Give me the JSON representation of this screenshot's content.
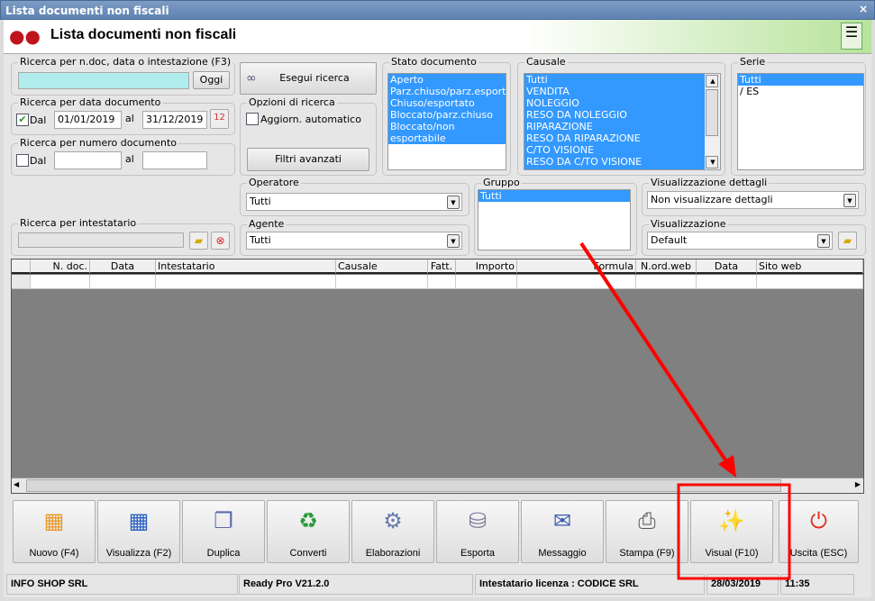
{
  "window": {
    "title": "Lista documenti non fiscali",
    "close": "×"
  },
  "header": {
    "title": "Lista documenti non fiscali"
  },
  "search_ndoc": {
    "legend": "Ricerca per n.doc, data o intestazione (F3)",
    "value": "",
    "today_button": "Oggi"
  },
  "search_date": {
    "legend": "Ricerca per data documento",
    "checked": true,
    "from_label": "Dal",
    "from": "01/01/2019",
    "to_label": "al",
    "to": "31/12/2019"
  },
  "search_number": {
    "legend": "Ricerca per numero documento",
    "checked": false,
    "from_label": "Dal",
    "from": "",
    "to_label": "al",
    "to": ""
  },
  "search_holder": {
    "legend": "Ricerca per intestatario",
    "value": ""
  },
  "run_search": "Esegui ricerca",
  "options": {
    "legend": "Opzioni di ricerca",
    "auto_update": "Aggiorn. automatico",
    "auto_update_checked": false,
    "advanced_filters": "Filtri avanzati"
  },
  "stato": {
    "legend": "Stato documento",
    "items": [
      "Aperto",
      "Parz.chiuso/parz.esportato",
      "Chiuso/esportato",
      "Bloccato/parz.chiuso",
      "Bloccato/non esportabile"
    ]
  },
  "causale": {
    "legend": "Causale",
    "items": [
      "Tutti",
      "VENDITA",
      "NOLEGGIO",
      "RESO DA NOLEGGIO",
      "RIPARAZIONE",
      "RESO DA RIPARAZIONE",
      "C/TO VISIONE",
      "RESO DA C/TO VISIONE"
    ]
  },
  "serie": {
    "legend": "Serie",
    "items": [
      "Tutti",
      "/ ES"
    ]
  },
  "operatore": {
    "legend": "Operatore",
    "value": "Tutti"
  },
  "agente": {
    "legend": "Agente",
    "value": "Tutti"
  },
  "gruppo": {
    "legend": "Gruppo",
    "items": [
      "Tutti"
    ]
  },
  "vis_dettagli": {
    "legend": "Visualizzazione dettagli",
    "value": "Non visualizzare dettagli"
  },
  "visualizzazione": {
    "legend": "Visualizzazione",
    "value": "Default"
  },
  "grid": {
    "columns": [
      "N. doc.",
      "Data",
      "Intestatario",
      "Causale",
      "Fatt.",
      "Importo",
      "Formula",
      "N.ord.web",
      "Data",
      "Sito web"
    ]
  },
  "toolbar": [
    {
      "label": "Nuovo (F4)",
      "icon": "new-grid-icon"
    },
    {
      "label": "Visualizza (F2)",
      "icon": "view-grid-icon"
    },
    {
      "label": "Duplica",
      "icon": "duplicate-icon"
    },
    {
      "label": "Converti",
      "icon": "convert-icon"
    },
    {
      "label": "Elaborazioni",
      "icon": "process-icon"
    },
    {
      "label": "Esporta",
      "icon": "export-database-icon"
    },
    {
      "label": "Messaggio",
      "icon": "message-icon"
    },
    {
      "label": "Stampa (F9)",
      "icon": "printer-icon"
    },
    {
      "label": "Visual (F10)",
      "icon": "magic-wand-icon"
    },
    {
      "label": "Uscita (ESC)",
      "icon": "power-icon"
    }
  ],
  "status": {
    "company": "INFO SHOP SRL",
    "version": "Ready Pro V21.2.0",
    "license": "Intestatario licenza : CODICE SRL",
    "date": "28/03/2019",
    "time": "11:35"
  },
  "colors": {
    "highlight": "#ff0000",
    "selection": "#3399ff",
    "search_input": "#b0ecec"
  }
}
